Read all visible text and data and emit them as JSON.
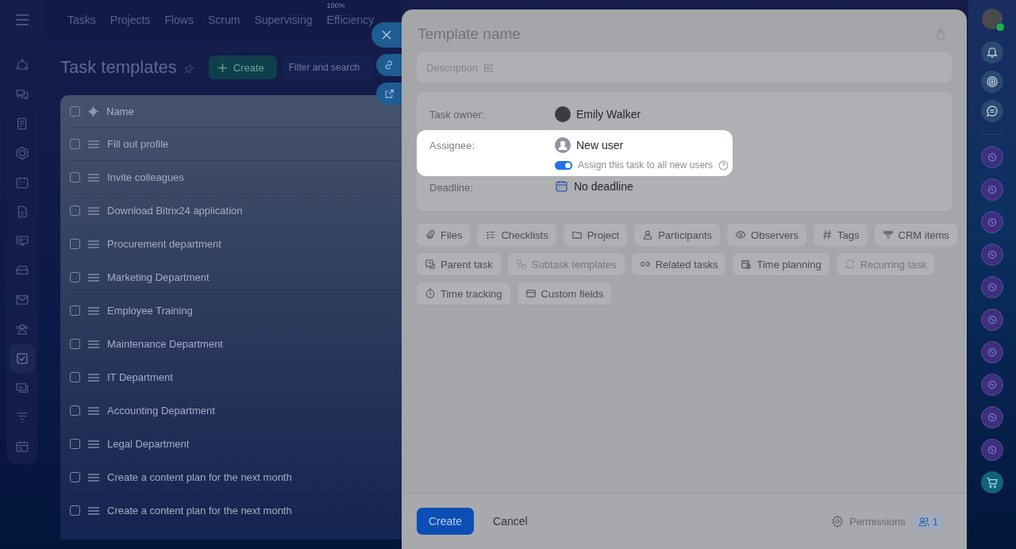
{
  "top_nav": {
    "items": [
      {
        "label": "Tasks"
      },
      {
        "label": "Projects"
      },
      {
        "label": "Flows"
      },
      {
        "label": "Scrum"
      },
      {
        "label": "Supervising"
      },
      {
        "label": "Efficiency",
        "badge": "100%"
      }
    ]
  },
  "left_sidebar": {
    "items": [
      {
        "selected": false
      },
      {
        "selected": false
      },
      {
        "selected": false
      },
      {
        "selected": false
      },
      {
        "selected": false
      },
      {
        "selected": false
      },
      {
        "selected": false
      },
      {
        "selected": false
      },
      {
        "selected": false
      },
      {
        "selected": false
      },
      {
        "selected": true
      },
      {
        "selected": false
      },
      {
        "selected": false
      },
      {
        "selected": false
      }
    ]
  },
  "page": {
    "title": "Task templates",
    "create_button": "Create",
    "search": {
      "placeholder": "Filter and search"
    }
  },
  "table": {
    "columns": [
      "Name"
    ],
    "all_checked": false,
    "rows": [
      {
        "name": "Fill out profile",
        "checked": false
      },
      {
        "name": "Invite colleagues",
        "checked": false
      },
      {
        "name": "Download Bitrix24 application",
        "checked": false
      },
      {
        "name": "Procurement department",
        "checked": false
      },
      {
        "name": "Marketing Department",
        "checked": false
      },
      {
        "name": "Employee Training",
        "checked": false
      },
      {
        "name": "Maintenance Department",
        "checked": false
      },
      {
        "name": "IT Department",
        "checked": false
      },
      {
        "name": "Accounting Department",
        "checked": false
      },
      {
        "name": "Legal Department",
        "checked": false
      },
      {
        "name": "Create a content plan for the next month",
        "checked": false
      },
      {
        "name": "Create a content plan for the next month",
        "checked": false
      }
    ]
  },
  "panel": {
    "title": {
      "placeholder": "Template name"
    },
    "description": {
      "placeholder": "Description"
    },
    "fields": [
      {
        "kind": "owner",
        "label": "Task owner:",
        "value": "Emily Walker",
        "highlighted": false
      },
      {
        "kind": "assignee",
        "label": "Assignee:",
        "value": "New user",
        "highlighted": true,
        "toggle": {
          "label": "Assign this task to all new users",
          "on": true
        }
      },
      {
        "kind": "deadline",
        "label": "Deadline:",
        "value": "No deadline",
        "highlighted": false
      }
    ],
    "chips": [
      {
        "label": "Files",
        "disabled": false
      },
      {
        "label": "Checklists",
        "disabled": false
      },
      {
        "label": "Project",
        "disabled": false
      },
      {
        "label": "Participants",
        "disabled": false
      },
      {
        "label": "Observers",
        "disabled": false
      },
      {
        "label": "Tags",
        "disabled": false
      },
      {
        "label": "CRM items",
        "disabled": false
      },
      {
        "label": "Parent task",
        "disabled": false
      },
      {
        "label": "Subtask templates",
        "disabled": true
      },
      {
        "label": "Related tasks",
        "disabled": false
      },
      {
        "label": "Time planning",
        "disabled": false
      },
      {
        "label": "Recurring task",
        "disabled": true
      },
      {
        "label": "Time tracking",
        "disabled": false
      },
      {
        "label": "Custom fields",
        "disabled": false
      }
    ],
    "footer": {
      "create": "Create",
      "cancel": "Cancel",
      "permissions": "Permissions",
      "members_count": "1"
    }
  }
}
